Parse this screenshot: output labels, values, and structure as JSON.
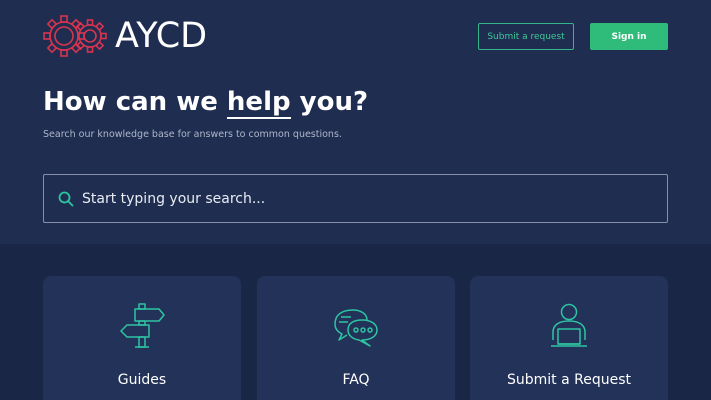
{
  "header": {
    "logo_text": "AYCD",
    "submit_request_label": "Submit a request",
    "sign_in_label": "Sign in"
  },
  "hero": {
    "title_before": "How can we ",
    "title_highlight": "help",
    "title_after": " you?",
    "subtitle": "Search our knowledge base for answers to common questions."
  },
  "search": {
    "placeholder": "Start typing your search..."
  },
  "cards": [
    {
      "label": "Guides",
      "icon": "signpost-icon"
    },
    {
      "label": "FAQ",
      "icon": "chat-bubbles-icon"
    },
    {
      "label": "Submit a Request",
      "icon": "person-laptop-icon"
    }
  ],
  "colors": {
    "background": "#1f2d50",
    "accent_green": "#2fbc7b",
    "logo_red": "#d8344f",
    "icon_teal": "#2ec4a2"
  }
}
